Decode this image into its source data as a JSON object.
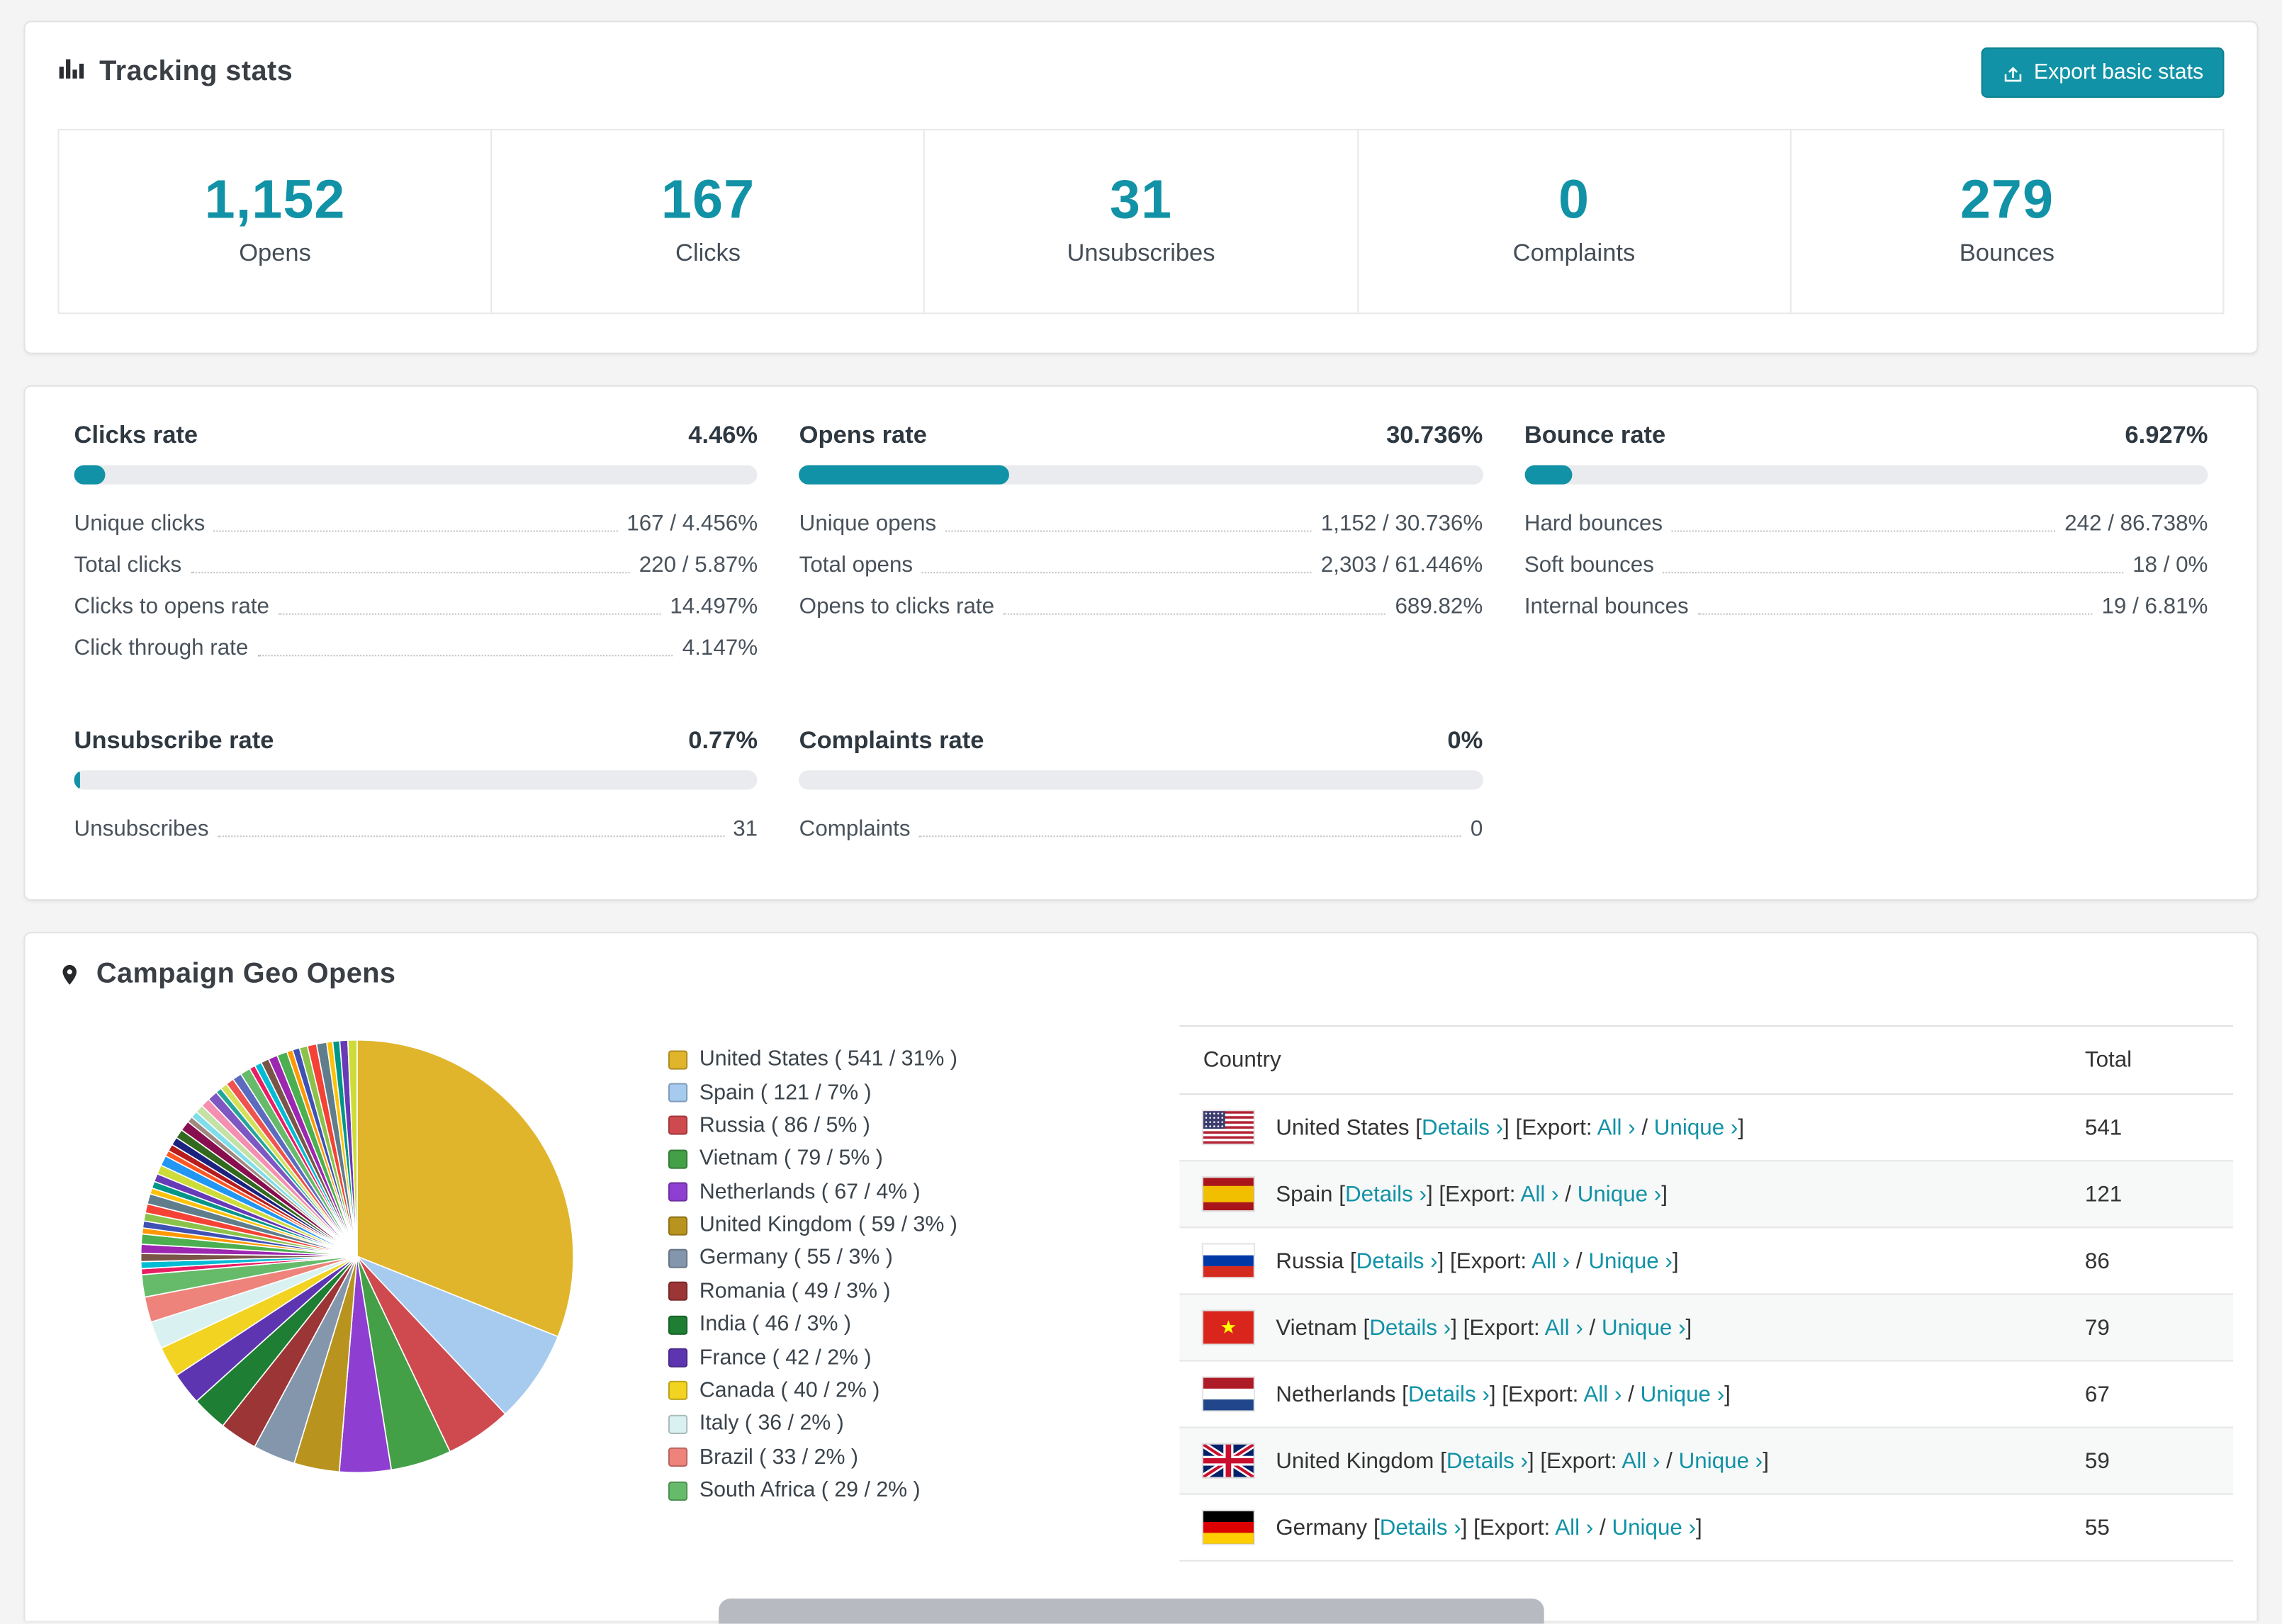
{
  "colors": {
    "accent": "#1192a6",
    "bar_track": "#e9ebee",
    "link": "#1192a6",
    "scrollbar": "#b7bbc1"
  },
  "tracking": {
    "title": "Tracking stats",
    "export_label": "Export basic stats",
    "stats": [
      {
        "value": "1,152",
        "label": "Opens"
      },
      {
        "value": "167",
        "label": "Clicks"
      },
      {
        "value": "31",
        "label": "Unsubscribes"
      },
      {
        "value": "0",
        "label": "Complaints"
      },
      {
        "value": "279",
        "label": "Bounces"
      }
    ]
  },
  "rates": [
    {
      "title": "Clicks rate",
      "value": "4.46%",
      "bar_percent": 4.46,
      "rows": [
        {
          "label": "Unique clicks",
          "value": "167 / 4.456%"
        },
        {
          "label": "Total clicks",
          "value": "220 / 5.87%"
        },
        {
          "label": "Clicks to opens rate",
          "value": "14.497%"
        },
        {
          "label": "Click through rate",
          "value": "4.147%"
        }
      ]
    },
    {
      "title": "Opens rate",
      "value": "30.736%",
      "bar_percent": 30.736,
      "rows": [
        {
          "label": "Unique opens",
          "value": "1,152 / 30.736%"
        },
        {
          "label": "Total opens",
          "value": "2,303 / 61.446%"
        },
        {
          "label": "Opens to clicks rate",
          "value": "689.82%"
        }
      ]
    },
    {
      "title": "Bounce rate",
      "value": "6.927%",
      "bar_percent": 6.927,
      "rows": [
        {
          "label": "Hard bounces",
          "value": "242 / 86.738%"
        },
        {
          "label": "Soft bounces",
          "value": "18 / 0%"
        },
        {
          "label": "Internal bounces",
          "value": "19 / 6.81%"
        }
      ]
    },
    {
      "title": "Unsubscribe rate",
      "value": "0.77%",
      "bar_percent": 0.77,
      "rows": [
        {
          "label": "Unsubscribes",
          "value": "31"
        }
      ]
    },
    {
      "title": "Complaints rate",
      "value": "0%",
      "bar_percent": 0,
      "rows": [
        {
          "label": "Complaints",
          "value": "0"
        }
      ]
    }
  ],
  "geo": {
    "title": "Campaign Geo Opens",
    "table": {
      "headers": {
        "country": "Country",
        "total": "Total"
      },
      "labels": {
        "bracket_open": "[",
        "bracket_close": "]",
        "details": "Details ›",
        "export": "Export:",
        "all": "All ›",
        "separator": "/",
        "unique": "Unique ›"
      },
      "rows": [
        {
          "country": "United States",
          "flag": "us",
          "total": "541"
        },
        {
          "country": "Spain",
          "flag": "es",
          "total": "121"
        },
        {
          "country": "Russia",
          "flag": "ru",
          "total": "86"
        },
        {
          "country": "Vietnam",
          "flag": "vn",
          "total": "79"
        },
        {
          "country": "Netherlands",
          "flag": "nl",
          "total": "67"
        },
        {
          "country": "United Kingdom",
          "flag": "gb",
          "total": "59"
        },
        {
          "country": "Germany",
          "flag": "de",
          "total": "55"
        }
      ]
    }
  },
  "chart_data": {
    "type": "pie",
    "title": "Campaign Geo Opens",
    "labels": [
      "United States",
      "Spain",
      "Russia",
      "Vietnam",
      "Netherlands",
      "United Kingdom",
      "Germany",
      "Romania",
      "India",
      "France",
      "Canada",
      "Italy",
      "Brazil",
      "South Africa"
    ],
    "values": [
      541,
      121,
      86,
      79,
      67,
      59,
      55,
      49,
      46,
      42,
      40,
      36,
      33,
      29
    ],
    "percents": [
      31,
      7,
      5,
      5,
      4,
      3,
      3,
      3,
      3,
      2,
      2,
      2,
      2,
      2
    ],
    "colors": [
      "#e0b52c",
      "#a6cbee",
      "#cf4a4e",
      "#43a047",
      "#8e3fd1",
      "#b8941f",
      "#8496ab",
      "#9c3535",
      "#1e7e34",
      "#5e35b1",
      "#f2d321",
      "#d9f2f1",
      "#ee837b",
      "#66bb6a"
    ],
    "others": {
      "total": 462,
      "slice_count": 44,
      "colors": [
        "#e91e63",
        "#00bcd4",
        "#795548",
        "#9c27b0",
        "#4caf50",
        "#ff9800",
        "#3f51b5",
        "#8bc34a",
        "#f44336",
        "#607d8b",
        "#ffc107",
        "#009688",
        "#673ab7",
        "#cddc39",
        "#2196f3",
        "#ff5722",
        "#b71c1c",
        "#1a237e",
        "#33691e",
        "#880e4f",
        "#a1887f",
        "#80deea",
        "#c5e1a5",
        "#f48fb1",
        "#7e57c2",
        "#26a69a",
        "#d4e157",
        "#ef5350",
        "#5c6bc0",
        "#66bb6a"
      ]
    },
    "legend_position": "right"
  }
}
